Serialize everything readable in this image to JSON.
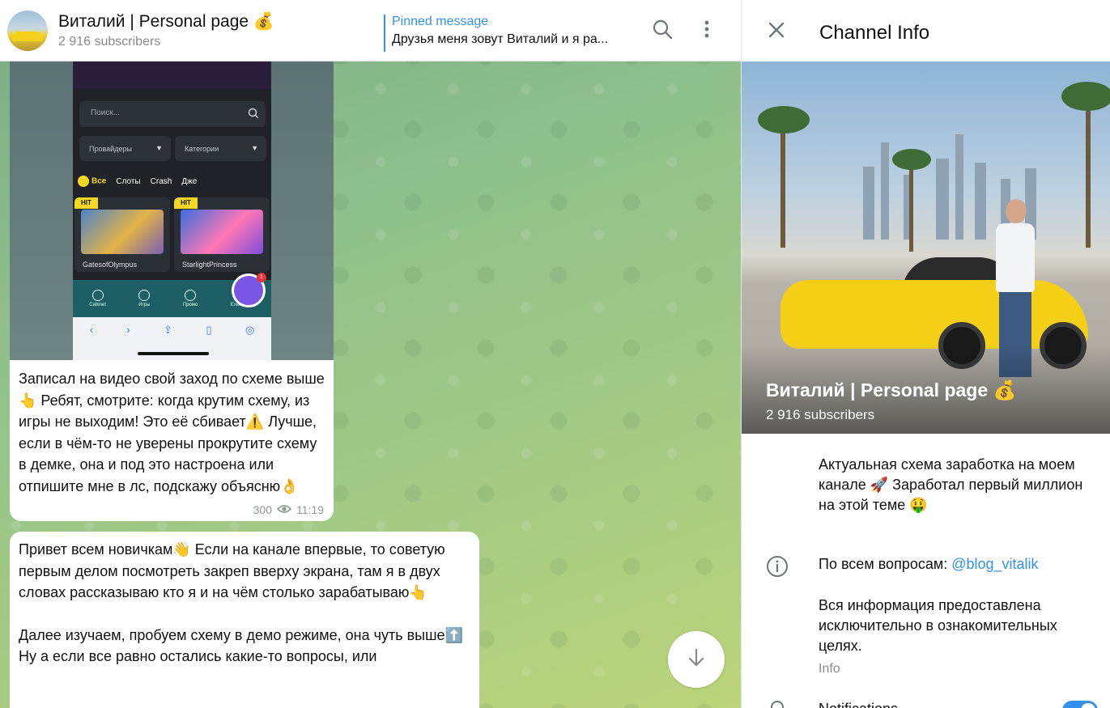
{
  "header": {
    "title": "Виталий | Personal page 💰",
    "subscribers": "2 916 subscribers",
    "pinned_label": "Pinned message",
    "pinned_text": "Друзья меня зовут Виталий и я ра..."
  },
  "media": {
    "search_placeholder": "Поиск...",
    "select_provider": "Провайдеры",
    "select_category": "Категории",
    "categories": [
      "Все",
      "Слоты",
      "Crash",
      "Дже"
    ],
    "games": [
      {
        "badge": "HIT",
        "name": "GatesofOlympus"
      },
      {
        "badge": "HIT",
        "name": "StarlightPrincess"
      }
    ],
    "nav": [
      "Cabinet",
      "Игры",
      "Промо",
      "Exeerience"
    ],
    "fab_count": "1"
  },
  "messages": [
    {
      "text": "Записал на видео свой заход по схеме выше👆 Ребят, смотрите: когда крутим схему, из игры не выходим! Это её сбивает⚠️ Лучше, если в чём-то не уверены прокрутите схему в демке, она и под это настроена или отпишите мне в лс, подскажу объясню👌",
      "views": "300",
      "time": "11:19"
    },
    {
      "paragraphs": [
        "Привет всем новичкам👋 Если на канале впервые, то советую первым делом посмотреть закреп вверху экрана, там я в двух словах рассказываю кто я и на чём столько зарабатываю👆",
        "Далее изучаем, пробуем схему в демо режиме, она чуть выше⬆️ Ну а если все равно остались какие-то вопросы, или"
      ]
    }
  ],
  "panel": {
    "title": "Channel Info",
    "cover_title": "Виталий | Personal page 💰",
    "cover_subscribers": "2 916 subscribers",
    "description": "Актуальная схема заработка на моем канале 🚀 Заработал первый миллион на этой теме 🤑",
    "contact_prefix": "По всем вопросам: ",
    "contact_link": "@blog_vitalik",
    "disclaimer": "Вся информация предоставлена исключительно в ознакомительных целях.",
    "info_label": "Info",
    "notifications_label": "Notifications",
    "notifications_on": true
  },
  "icons": {
    "search": "search-icon",
    "more": "more-vertical-icon",
    "close": "close-icon",
    "info": "info-icon",
    "bell": "bell-icon",
    "arrow_down": "arrow-down-icon",
    "views": "eye-icon"
  },
  "colors": {
    "accent": "#3390ec",
    "chat_bg": "#8fc08c"
  }
}
